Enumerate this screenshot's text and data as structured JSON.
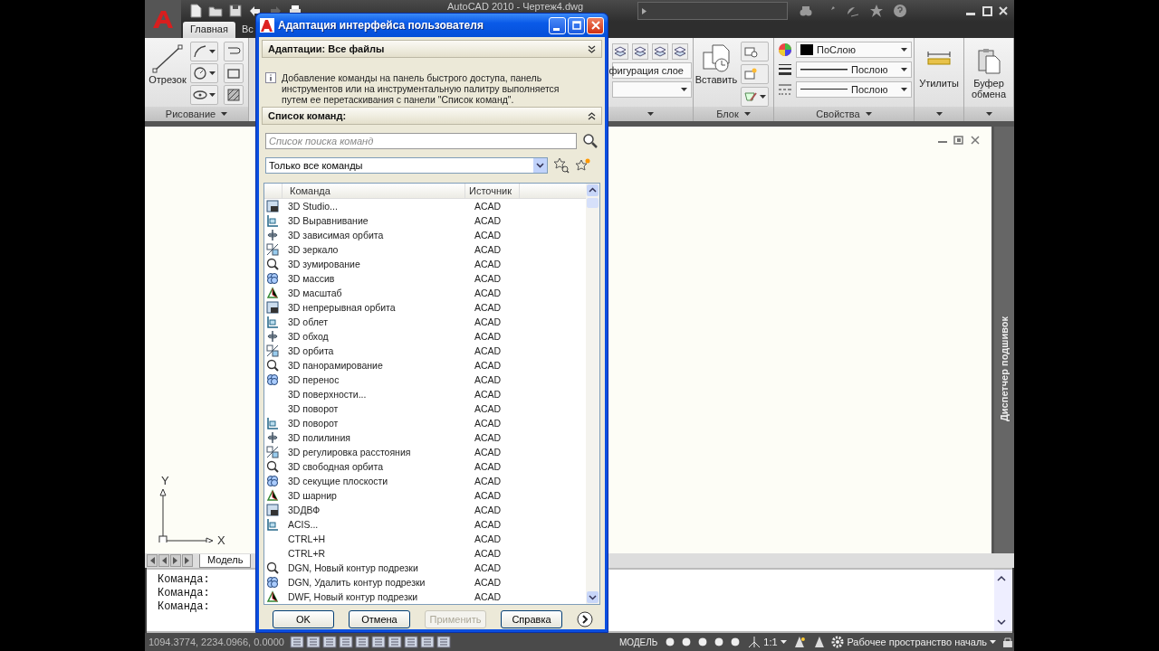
{
  "app": {
    "title": "AutoCAD 2010 - Чертеж4.dwg",
    "tabs": [
      {
        "label": "Главная",
        "selected": true
      },
      {
        "label": "Вс",
        "selected": false
      }
    ],
    "ribbon": {
      "draw_panel": {
        "big_button": "Отрезок",
        "footer": "Рисование"
      },
      "layers_panel": {
        "combo": "фигурация слое"
      },
      "block_panel": {
        "big_button": "Вставить",
        "footer": "Блок"
      },
      "properties_panel": {
        "color_setting": "ПоСлою",
        "lineweight": "Послою",
        "linetype": "Послою",
        "footer": "Свойства"
      },
      "utilities": "Утилиты",
      "clipboard": "Буфер обмена"
    },
    "viewport": {
      "axis_y": "Y",
      "axis_x": "X"
    },
    "side_palette": "Диспетчер подшивок",
    "layout_tabs": [
      {
        "label": "Модель",
        "selected": true
      }
    ],
    "command_lines": [
      "Команда:",
      "Команда:",
      "Команда:"
    ],
    "status_bar": {
      "coordinates": "1094.3774, 2234.0966, 0.0000",
      "model": "МОДЕЛЬ",
      "scale": "1:1",
      "workspace": "Рабочее пространство началь"
    }
  },
  "dialog": {
    "title": "Адаптация интерфейса пользователя",
    "customizations": {
      "label": "Адаптации: Все файлы",
      "expanded": false
    },
    "info": "Добавление команды на панель быстрого доступа, панель инструментов или на инструментальную палитру выполняется путем ее перетаскивания с панели \"Список команд\".",
    "command_list": {
      "label": "Список команд:",
      "expanded": true,
      "search": {
        "placeholder": "Список поиска команд"
      },
      "filter": "Только все команды",
      "columns": [
        "Команда",
        "Источник"
      ],
      "rows": [
        {
          "name": "3D Studio...",
          "source": "ACAD",
          "icon": true
        },
        {
          "name": "3D Выравнивание",
          "source": "ACAD",
          "icon": true
        },
        {
          "name": "3D зависимая орбита",
          "source": "ACAD",
          "icon": true
        },
        {
          "name": "3D зеркало",
          "source": "ACAD",
          "icon": true
        },
        {
          "name": "3D зумирование",
          "source": "ACAD",
          "icon": true
        },
        {
          "name": "3D массив",
          "source": "ACAD",
          "icon": true
        },
        {
          "name": "3D масштаб",
          "source": "ACAD",
          "icon": true
        },
        {
          "name": "3D непрерывная орбита",
          "source": "ACAD",
          "icon": true
        },
        {
          "name": "3D облет",
          "source": "ACAD",
          "icon": true
        },
        {
          "name": "3D обход",
          "source": "ACAD",
          "icon": true
        },
        {
          "name": "3D орбита",
          "source": "ACAD",
          "icon": true
        },
        {
          "name": "3D панорамирование",
          "source": "ACAD",
          "icon": true
        },
        {
          "name": "3D перенос",
          "source": "ACAD",
          "icon": true
        },
        {
          "name": "3D поверхности...",
          "source": "ACAD",
          "icon": false
        },
        {
          "name": "3D поворот",
          "source": "ACAD",
          "icon": false
        },
        {
          "name": "3D поворот",
          "source": "ACAD",
          "icon": true
        },
        {
          "name": "3D полилиния",
          "source": "ACAD",
          "icon": true
        },
        {
          "name": "3D регулировка расстояния",
          "source": "ACAD",
          "icon": true
        },
        {
          "name": "3D свободная орбита",
          "source": "ACAD",
          "icon": true
        },
        {
          "name": "3D секущие плоскости",
          "source": "ACAD",
          "icon": true
        },
        {
          "name": "3D шарнир",
          "source": "ACAD",
          "icon": true
        },
        {
          "name": "3DДВФ",
          "source": "ACAD",
          "icon": true
        },
        {
          "name": "ACIS...",
          "source": "ACAD",
          "icon": true
        },
        {
          "name": "CTRL+H",
          "source": "ACAD",
          "icon": false
        },
        {
          "name": "CTRL+R",
          "source": "ACAD",
          "icon": false
        },
        {
          "name": "DGN, Новый контур подрезки",
          "source": "ACAD",
          "icon": true
        },
        {
          "name": "DGN, Удалить контур подрезки",
          "source": "ACAD",
          "icon": true
        },
        {
          "name": "DWF, Новый контур подрезки",
          "source": "ACAD",
          "icon": true
        }
      ]
    },
    "buttons": [
      {
        "label": "OK",
        "disabled": false
      },
      {
        "label": "Отмена",
        "disabled": false
      },
      {
        "label": "Применить",
        "disabled": true
      },
      {
        "label": "Справка",
        "disabled": false
      }
    ]
  }
}
